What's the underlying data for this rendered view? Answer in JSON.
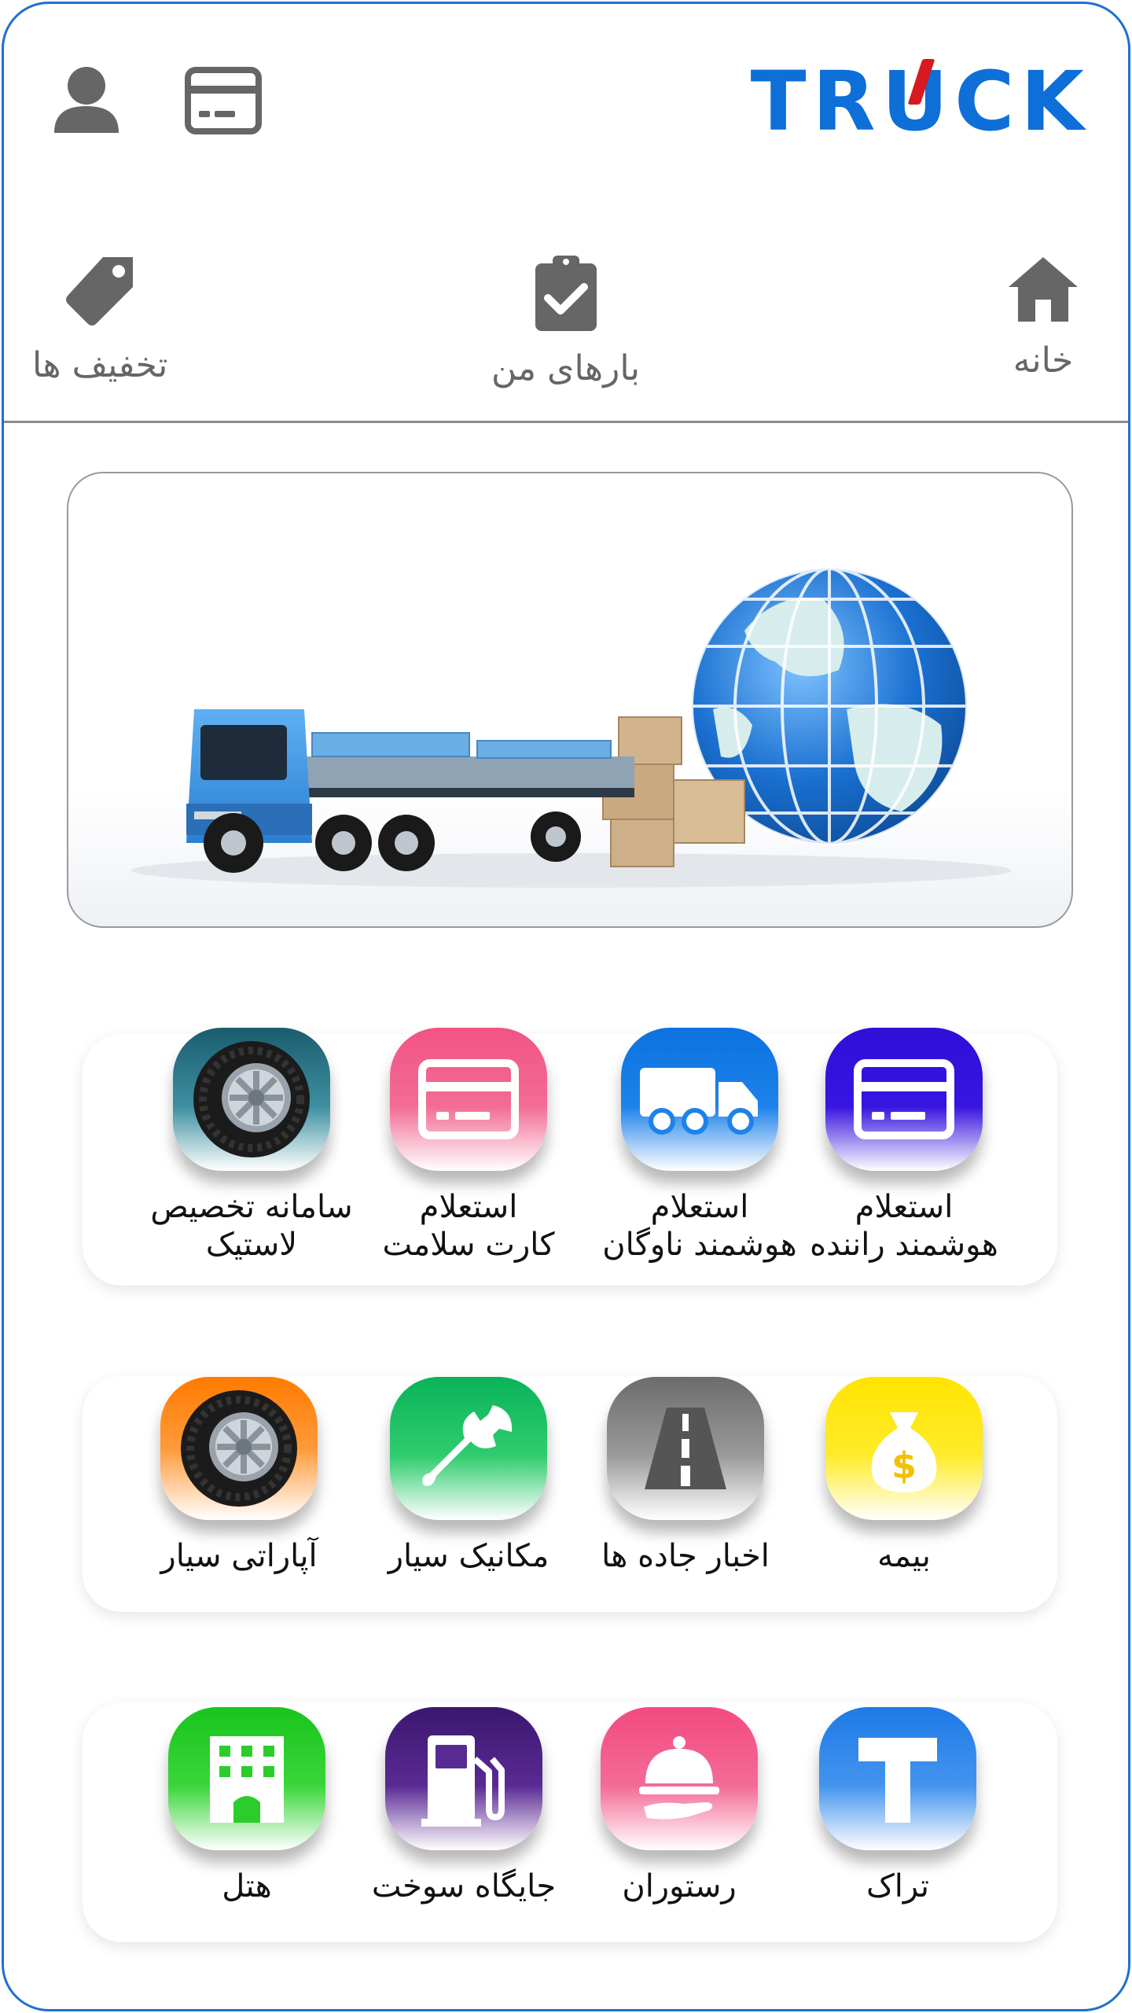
{
  "header": {
    "logo_text": "TRUCK"
  },
  "nav": {
    "items": [
      {
        "label": "خانه",
        "icon": "home-icon"
      },
      {
        "label": "بارهای من",
        "icon": "clipboard-check-icon"
      },
      {
        "label": "تخفیف ها",
        "icon": "tag-icon"
      }
    ]
  },
  "banner": {
    "alt": "truck-and-globe-illustration"
  },
  "services": {
    "row1": [
      {
        "line1": "استعلام",
        "line2": "هوشمند راننده"
      },
      {
        "line1": "استعلام",
        "line2": "هوشمند ناوگان"
      },
      {
        "line1": "استعلام",
        "line2": "کارت سلامت"
      },
      {
        "line1": "سامانه تخصیص",
        "line2": "لاستیک"
      }
    ],
    "row2": [
      {
        "label": "بیمه"
      },
      {
        "label": "اخبار جاده ها"
      },
      {
        "label": "مکانیک سیار"
      },
      {
        "label": "آپاراتی سیار"
      }
    ],
    "row3": [
      {
        "label": "تراک"
      },
      {
        "label": "رستوران"
      },
      {
        "label": "جایگاه سوخت"
      },
      {
        "label": "هتل"
      }
    ]
  },
  "colors": {
    "brand_blue": "#0d6fd7",
    "brand_red": "#d71920",
    "frame_border": "#1f6fd1",
    "nav_text": "#666666"
  }
}
